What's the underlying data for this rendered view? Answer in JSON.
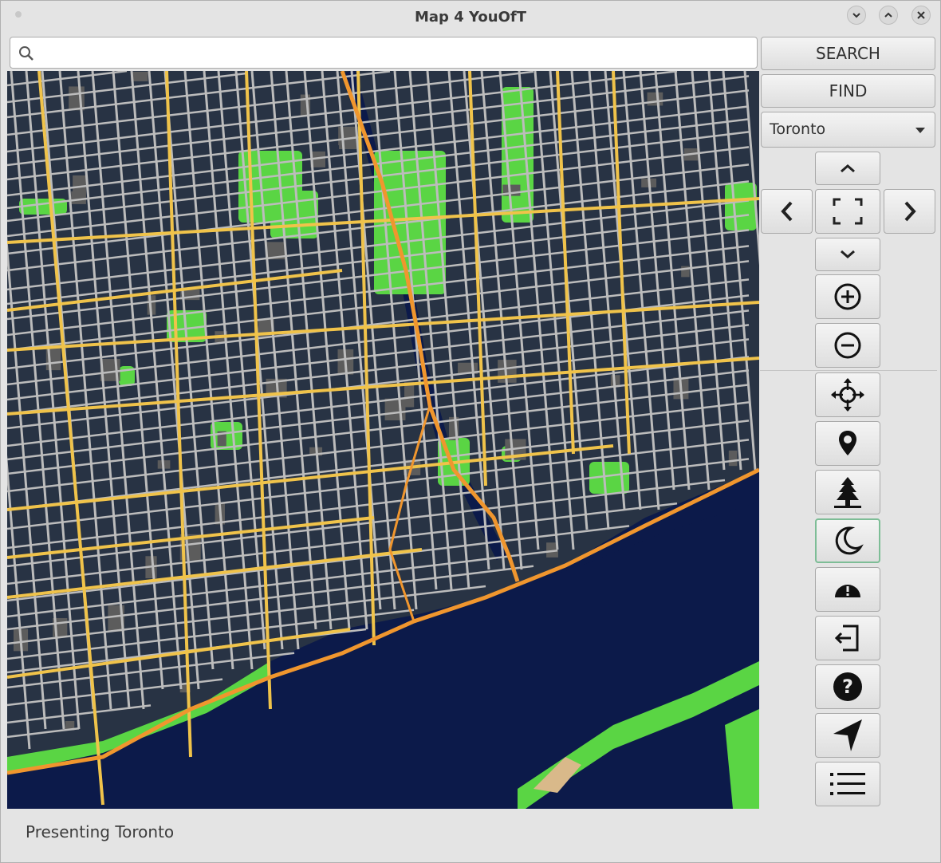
{
  "window": {
    "title": "Map 4 YouOfT"
  },
  "search": {
    "value": "",
    "placeholder": ""
  },
  "buttons": {
    "search": "SEARCH",
    "find": "FIND"
  },
  "city_select": {
    "selected": "Toronto"
  },
  "status": {
    "text": "Presenting Toronto"
  },
  "icons": {
    "window_controls": [
      "chevron-down-icon",
      "chevron-up-icon",
      "close-icon"
    ],
    "nav": [
      "chevron-up-icon",
      "chevron-left-icon",
      "fullscreen-icon",
      "chevron-right-icon",
      "chevron-down-icon"
    ],
    "zoom": [
      "zoom-in-icon",
      "zoom-out-icon"
    ],
    "tools": [
      "move-arrows-icon",
      "map-pin-icon",
      "tree-icon",
      "moon-icon",
      "hazard-icon",
      "logout-icon",
      "help-icon",
      "navigate-arrow-icon",
      "list-icon"
    ]
  },
  "map": {
    "theme": "night",
    "colors": {
      "land": "#283344",
      "water": "#0c1a4a",
      "minor_road": "#bcbcbc",
      "major_road": "#f0c34a",
      "highway": "#f0962e",
      "park": "#5ad544",
      "building": "#5c5c5c",
      "beach": "#d9b98a"
    }
  }
}
